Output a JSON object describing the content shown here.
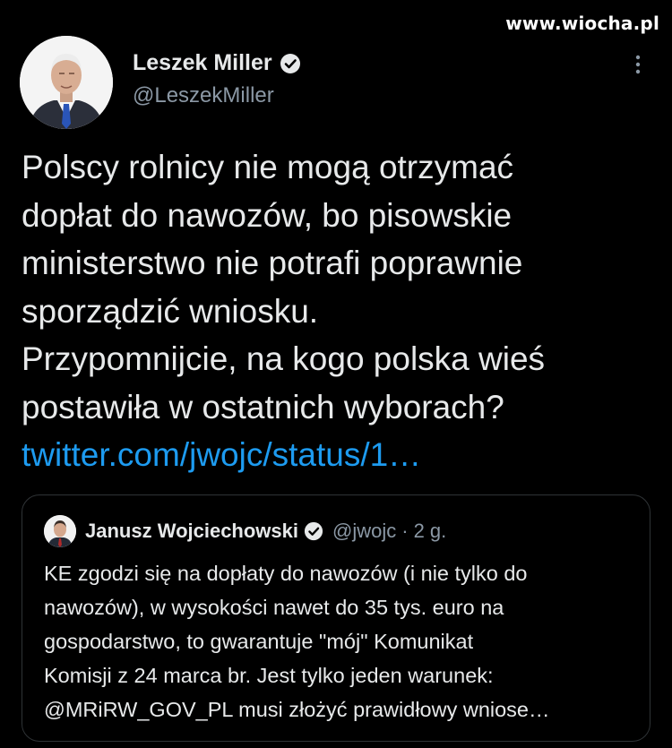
{
  "watermark": "www.wiocha.pl",
  "tweet": {
    "author": {
      "display_name": "Leszek Miller",
      "handle": "@LeszekMiller",
      "verified_icon": "verified-badge-icon"
    },
    "text_lines": [
      "Polscy rolnicy nie mogą otrzymać",
      "dopłat do nawozów, bo pisowskie",
      "ministerstwo nie potrafi poprawnie",
      "sporządzić wniosku.",
      "Przypomnijcie, na kogo polska wieś",
      "postawiła w ostatnich wyborach?"
    ],
    "link": "twitter.com/jwojc/status/1…",
    "more_icon": "more-vertical-icon"
  },
  "quoted_tweet": {
    "display_name": "Janusz Wojciechowski",
    "handle": "@jwojc",
    "separator": "·",
    "time": "2 g.",
    "text_lines": [
      "KE zgodzi się na dopłaty do nawozów (i nie tylko do",
      "nawozów), w wysokości nawet do 35 tys. euro na",
      "gospodarstwo, to gwarantuje \"mój\" Komunikat",
      "Komisji z 24 marca br. Jest tylko jeden warunek:",
      "@MRiRW_GOV_PL musi złożyć prawidłowy wniose…"
    ]
  },
  "colors": {
    "background": "#000000",
    "text": "#e7e9ea",
    "secondary": "#8b98a5",
    "link": "#1d9bf0",
    "border": "#2f3336"
  }
}
